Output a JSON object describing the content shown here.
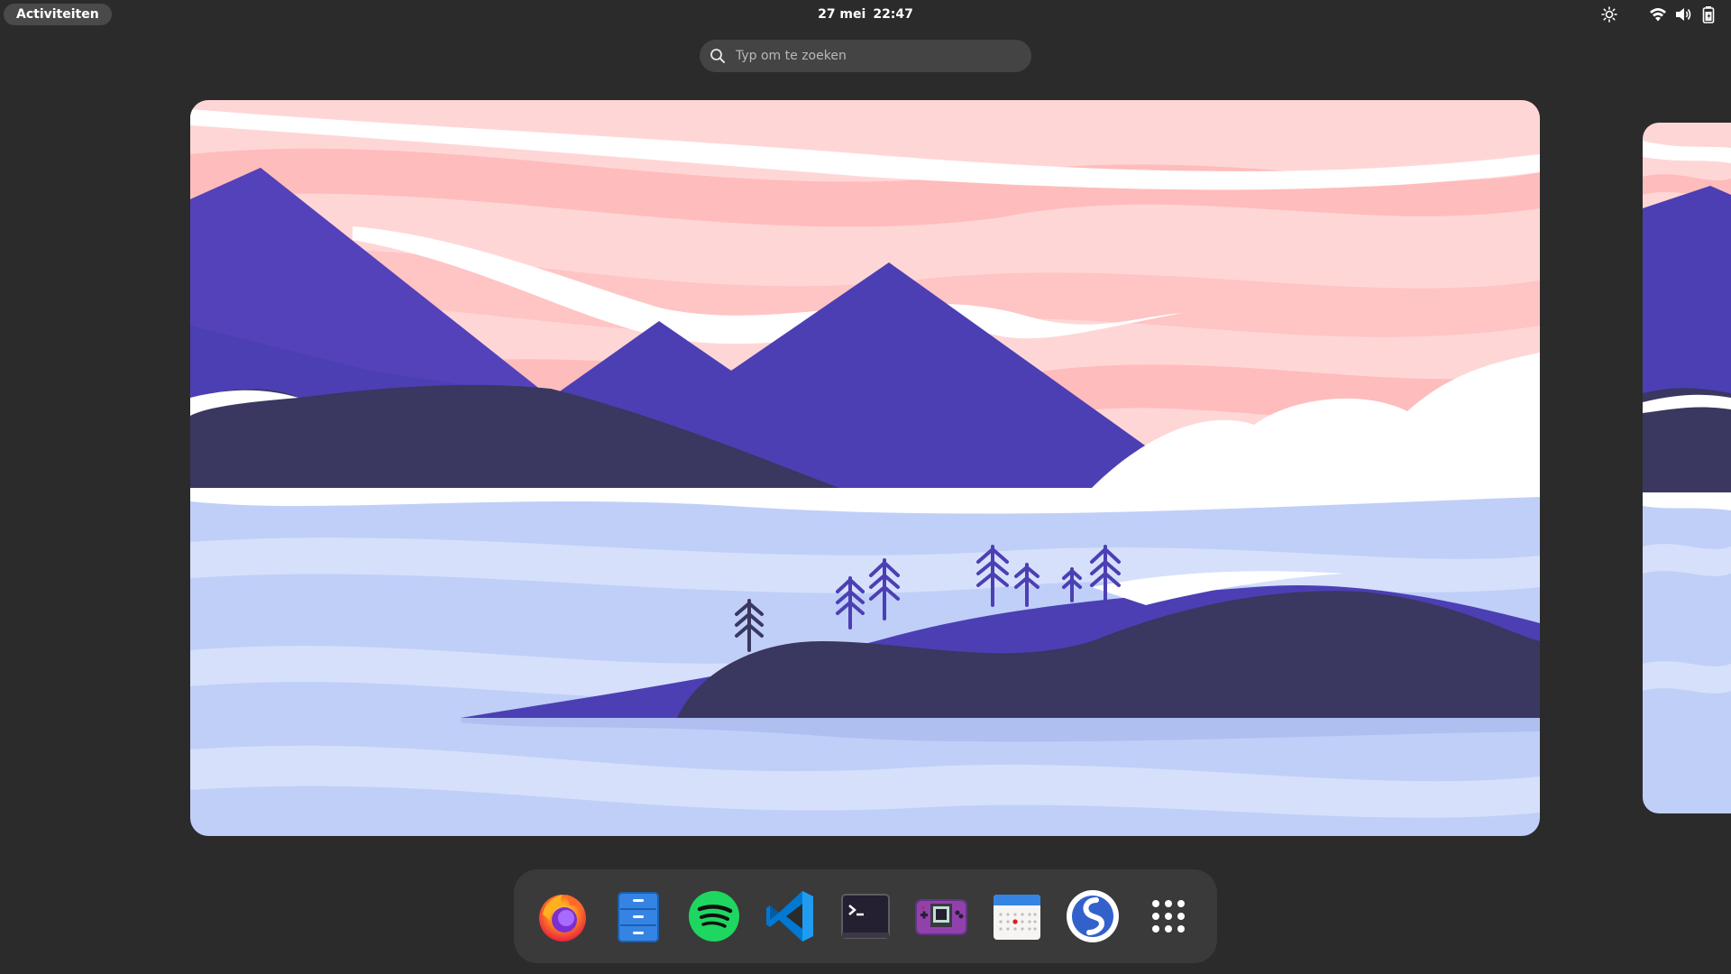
{
  "topbar": {
    "activities_label": "Activiteiten",
    "date": "27 mei",
    "time": "22:47",
    "tray": [
      "brightness-icon",
      "wifi-icon",
      "volume-icon",
      "battery-icon"
    ]
  },
  "search": {
    "placeholder": "Typ om te zoeken"
  },
  "workspaces": {
    "count_visible": 2,
    "wallpaper_colors": {
      "sky": "#ffd6d6",
      "clouds_pink": "#ffbcbc",
      "mountain": "#4c3fb4",
      "hill_dark": "#3a3760",
      "water": "#bfcff8",
      "water_light": "#d6e0fb"
    }
  },
  "dash": {
    "apps": [
      {
        "name": "firefox",
        "icon": "firefox-icon"
      },
      {
        "name": "files",
        "icon": "files-icon"
      },
      {
        "name": "spotify",
        "icon": "spotify-icon"
      },
      {
        "name": "vscode",
        "icon": "vscode-icon"
      },
      {
        "name": "terminal",
        "icon": "terminal-icon"
      },
      {
        "name": "game-console",
        "icon": "gameboy-icon"
      },
      {
        "name": "calendar",
        "icon": "calendar-icon"
      },
      {
        "name": "simplenote",
        "icon": "simplenote-icon"
      },
      {
        "name": "show-applications",
        "icon": "app-grid-icon"
      }
    ]
  },
  "colors": {
    "panel_bg": "#2b2b2b",
    "button_bg": "#4a4a4a",
    "dash_bg": "#3a3a3a",
    "search_bg": "#444444"
  }
}
